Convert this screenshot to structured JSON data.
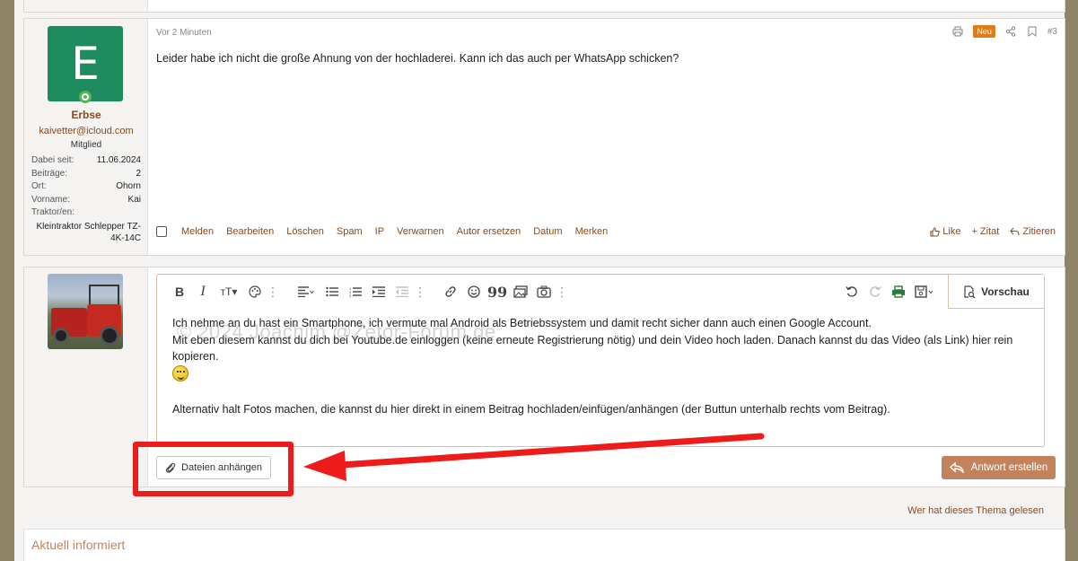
{
  "post": {
    "time": "Vor 2 Minuten",
    "new_badge": "Neu",
    "number": "#3",
    "content": "Leider habe ich nicht die große Ahnung von der hochladerei. Kann ich das auch per WhatsApp schicken?",
    "author": {
      "avatar_letter": "E",
      "avatar_color": "#1e8b5e",
      "name": "Erbse",
      "email": "kaivetter@icloud.com",
      "role": "Mitglied",
      "info": [
        {
          "label": "Dabei seit:",
          "value": "11.06.2024"
        },
        {
          "label": "Beiträge:",
          "value": "2"
        },
        {
          "label": "Ort:",
          "value": "Ohorn"
        },
        {
          "label": "Vorname:",
          "value": "Kai"
        },
        {
          "label": "Traktor/en:",
          "value": "Kleintraktor Schlepper TZ-4K-14C"
        }
      ]
    },
    "actions": [
      "Melden",
      "Bearbeiten",
      "Löschen",
      "Spam",
      "IP",
      "Verwarnen",
      "Autor ersetzen",
      "Datum",
      "Merken"
    ],
    "right_actions": {
      "like": "Like",
      "zitat": "Zitat",
      "zitieren": "Zitieren"
    }
  },
  "editor": {
    "preview_label": "Vorschau",
    "lines": [
      "Ich nehme an du hast ein Smartphone, ich vermute mal Android als Betriebssystem und damit recht sicher dann auch einen Google Account.",
      "Mit eben diesem kannst du dich bei Youtube.de einloggen (keine erneute Registrierung nötig) und dein Video hoch laden. Danach kannst du das Video (als Link) hier rein kopieren.",
      "Alternativ halt Fotos machen, die kannst du hier direkt in einem Beitrag hochladen/einfügen/anhängen (der Buttun unterhalb rechts vom Beitrag)."
    ],
    "watermark": "© 2024 Joachim @Zetor-Forum.de",
    "attach_label": "Dateien anhängen",
    "submit_label": "Antwort erstellen"
  },
  "who_read": "Wer hat dieses Thema gelesen",
  "footer_title": "Aktuell informiert",
  "colors": {
    "accent": "#c2835c",
    "link": "#8a4a1f",
    "annotation": "#ee1b1b"
  }
}
